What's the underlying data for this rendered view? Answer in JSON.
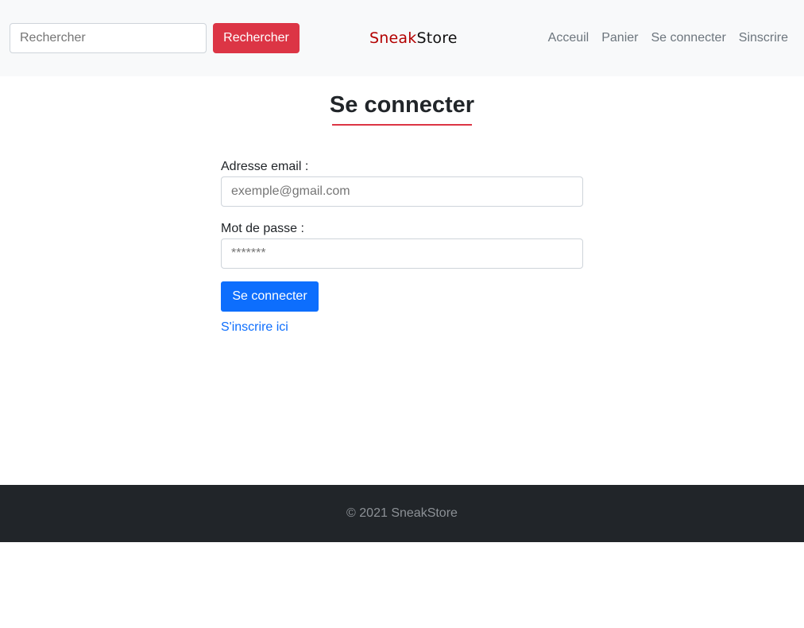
{
  "header": {
    "search": {
      "placeholder": "Rechercher"
    },
    "search_button": "Rechercher",
    "brand": {
      "part1": "Sneak",
      "part2": "Store"
    },
    "nav": [
      "Acceuil",
      "Panier",
      "Se connecter",
      "Sinscrire"
    ]
  },
  "main": {
    "title": "Se connecter",
    "email": {
      "label": "Adresse email :",
      "placeholder": "exemple@gmail.com"
    },
    "password": {
      "label": "Mot de passe :",
      "placeholder": "*******"
    },
    "submit": "Se connecter",
    "register_link": "S'inscrire ici"
  },
  "footer": {
    "text": "© 2021 SneakStore"
  },
  "colors": {
    "navbar_bg": "#f8f9fa",
    "search_button": "#dc3545",
    "brand_accent": "#b30000",
    "title_underline": "#dc3545",
    "primary": "#0d6efd",
    "footer_bg": "#212529"
  }
}
